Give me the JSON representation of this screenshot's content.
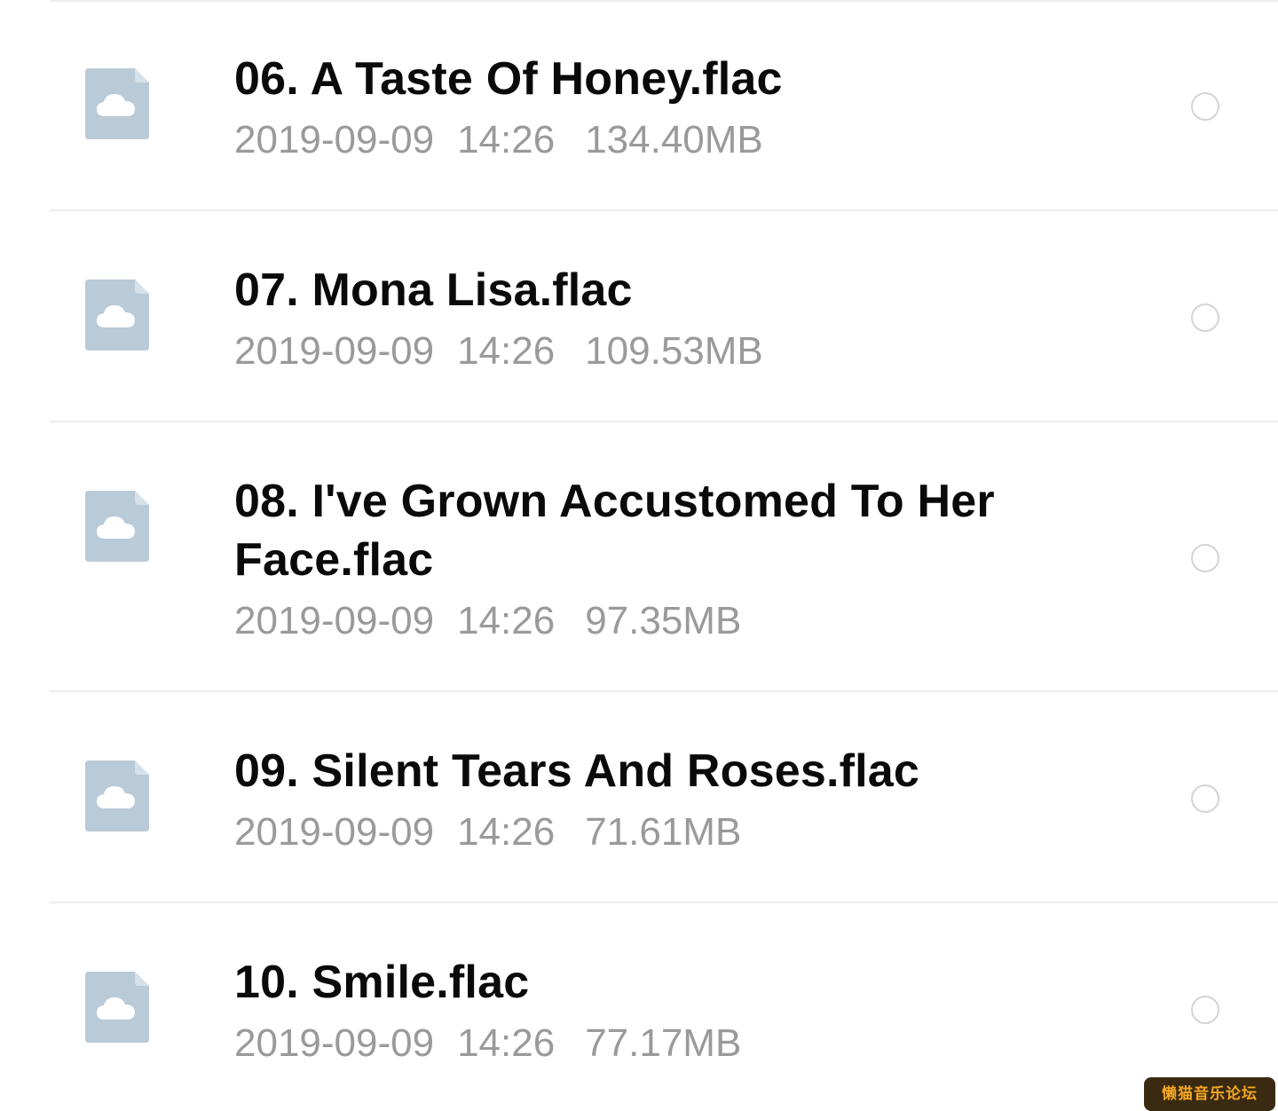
{
  "files": [
    {
      "name": "06. A Taste Of Honey.flac",
      "date": "2019-09-09",
      "time": "14:26",
      "size": "134.40MB",
      "selected": false
    },
    {
      "name": "07. Mona Lisa.flac",
      "date": "2019-09-09",
      "time": "14:26",
      "size": "109.53MB",
      "selected": false
    },
    {
      "name": "08. I've Grown Accustomed To Her Face.flac",
      "date": "2019-09-09",
      "time": "14:26",
      "size": "97.35MB",
      "selected": false
    },
    {
      "name": "09. Silent Tears And Roses.flac",
      "date": "2019-09-09",
      "time": "14:26",
      "size": "71.61MB",
      "selected": false
    },
    {
      "name": "10. Smile.flac",
      "date": "2019-09-09",
      "time": "14:26",
      "size": "77.17MB",
      "selected": false
    }
  ],
  "file_icon": "cloud-file-icon",
  "colors": {
    "icon_fill": "#b9cad8",
    "icon_fold": "#d6e1ea",
    "name_text": "#0a0a0a",
    "meta_text": "#9a9a9a",
    "divider": "#ececec",
    "radio_border": "#d4d4d4"
  },
  "watermark": {
    "text": "懒猫音乐论坛"
  }
}
